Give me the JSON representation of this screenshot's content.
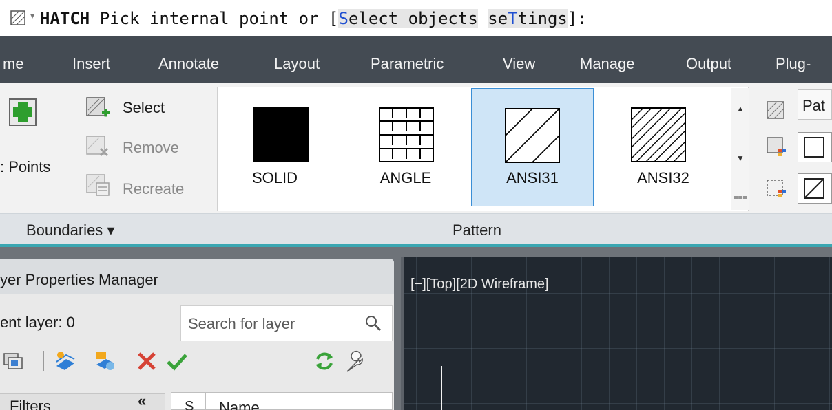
{
  "command_line": {
    "prompt_arrow": "▾",
    "command": "HATCH",
    "prompt": " Pick internal point or [",
    "option1_hotkey": "S",
    "option1_rest": "elect objects",
    "option2_pre": "se",
    "option2_hotkey": "T",
    "option2_post": "tings",
    "suffix": "]:"
  },
  "ribbon_tabs": [
    "me",
    "Insert",
    "Annotate",
    "Layout",
    "Parametric",
    "View",
    "Manage",
    "Output",
    "Plug-"
  ],
  "boundaries_panel": {
    "pick_points_label": ": Points",
    "select_label": "Select",
    "remove_label": "Remove",
    "recreate_label": "Recreate",
    "title": "Boundaries ▾"
  },
  "pattern_panel": {
    "title": "Pattern",
    "swatches": [
      {
        "label": "SOLID",
        "selected": false
      },
      {
        "label": "ANGLE",
        "selected": false
      },
      {
        "label": "ANSI31",
        "selected": true
      },
      {
        "label": "ANSI32",
        "selected": false
      }
    ],
    "scroll_up": "▲",
    "scroll_down": "▼",
    "scroll_more": "⩶"
  },
  "properties_panel": {
    "pattern_value": "Pat"
  },
  "layer_manager": {
    "title": "yer Properties Manager",
    "current_layer": "ent layer: 0",
    "search_placeholder": "Search for layer",
    "filters_label": "Filters",
    "filters_collapse": "«",
    "column_status": "S",
    "column_name": "Name"
  },
  "viewport": {
    "label": "[−][Top][2D Wireframe]"
  },
  "colors": {
    "tab_bar": "#444b53",
    "accent": "#3aa7b2",
    "selected_swatch": "#cfe5f7",
    "viewport_bg": "#212830",
    "hotkey_blue": "#1f4fd1"
  }
}
